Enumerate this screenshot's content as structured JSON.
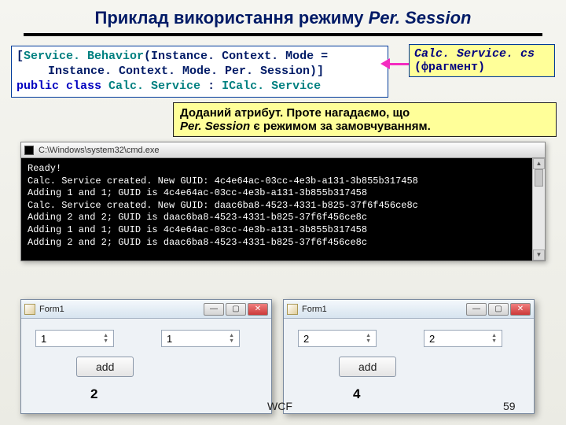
{
  "title": {
    "pre": "Приклад використання режиму ",
    "italic": "Per. Session"
  },
  "code": {
    "l1a": "[",
    "l1b": "Service. Behavior",
    "l1c": "(Instance. Context. Mode =",
    "l2": "Instance. Context. Mode. Per. Session)]",
    "l3a": "public",
    "l3b": " class ",
    "l3c": "Calc. Service",
    "l3d": " : ",
    "l3e": "ICalc. Service"
  },
  "yellow": {
    "file": "Calc. Service. cs",
    "frag": "(фрагмент)"
  },
  "note": {
    "l1": "Доданий атрибут. Проте нагадаємо, що",
    "l2a": "Per. Session",
    "l2b": " є режимом за замовчуванням."
  },
  "cmd": {
    "title": "C:\\Windows\\system32\\cmd.exe",
    "lines": [
      "Ready!",
      "Calc. Service created. New GUID: 4c4e64ac-03cc-4e3b-a131-3b855b317458",
      "Adding 1 and 1; GUID is 4c4e64ac-03cc-4e3b-a131-3b855b317458",
      "Calc. Service created. New GUID: daac6ba8-4523-4331-b825-37f6f456ce8c",
      "Adding 2 and 2; GUID is daac6ba8-4523-4331-b825-37f6f456ce8c",
      "Adding 1 and 1; GUID is 4c4e64ac-03cc-4e3b-a131-3b855b317458",
      "Adding 2 and 2; GUID is daac6ba8-4523-4331-b825-37f6f456ce8c"
    ]
  },
  "forms": [
    {
      "title": "Form1",
      "a": "1",
      "b": "1",
      "btn": "add",
      "result": "2"
    },
    {
      "title": "Form1",
      "a": "2",
      "b": "2",
      "btn": "add",
      "result": "4"
    }
  ],
  "footer": {
    "wcf": "WCF",
    "page": "59"
  }
}
